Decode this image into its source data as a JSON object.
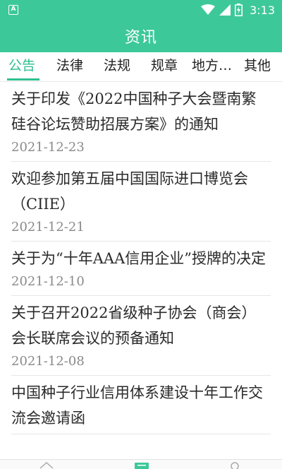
{
  "status_bar": {
    "time": "3:13",
    "notification_glyph": "A",
    "icons": [
      "wifi-icon",
      "signal-icon",
      "battery-icon"
    ]
  },
  "app_bar": {
    "title": "资讯"
  },
  "tabs": [
    {
      "label": "公告",
      "active": true
    },
    {
      "label": "法律",
      "active": false
    },
    {
      "label": "法规",
      "active": false
    },
    {
      "label": "规章",
      "active": false
    },
    {
      "label": "地方…",
      "active": false
    },
    {
      "label": "其他",
      "active": false
    }
  ],
  "news": [
    {
      "title": "关于印发《2022中国种子大会暨南繁硅谷论坛赞助招展方案》的通知",
      "date": "2021-12-23"
    },
    {
      "title": "欢迎参加第五届中国国际进口博览会（CIIE）",
      "date": "2021-12-21"
    },
    {
      "title": "关于为“十年AAA信用企业”授牌的决定",
      "date": "2021-12-10"
    },
    {
      "title": "关于召开2022省级种子协会（商会）会长联席会议的预备通知",
      "date": "2021-12-08"
    },
    {
      "title": "中国种子行业信用体系建设十年工作交流会邀请函",
      "date": ""
    }
  ],
  "bottom_nav": {
    "icons": [
      "home-icon",
      "news-icon",
      "profile-icon"
    ]
  },
  "colors": {
    "accent": "#3dc89a",
    "tab_active": "#2fbf91"
  }
}
